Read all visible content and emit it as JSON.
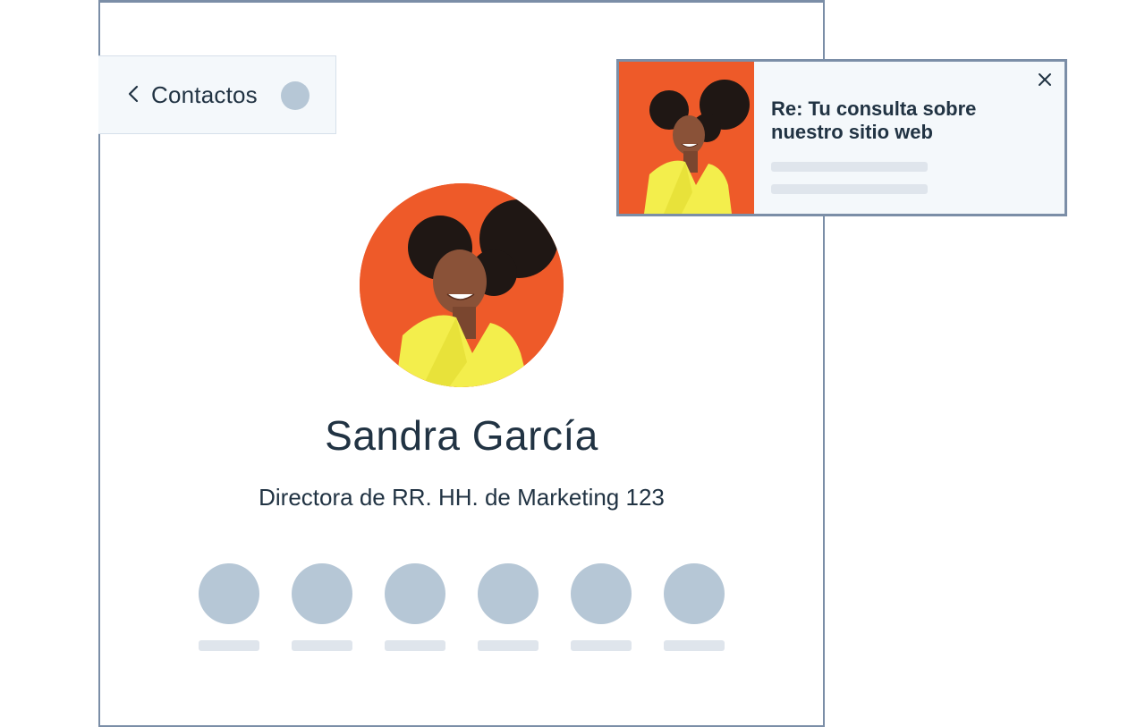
{
  "navigation": {
    "back_label": "Contactos"
  },
  "contact": {
    "name": "Sandra García",
    "title": "Directora de RR. HH. de Marketing 123"
  },
  "actions": [
    {
      "icon": "action-placeholder-icon"
    },
    {
      "icon": "action-placeholder-icon"
    },
    {
      "icon": "action-placeholder-icon"
    },
    {
      "icon": "action-placeholder-icon"
    },
    {
      "icon": "action-placeholder-icon"
    },
    {
      "icon": "action-placeholder-icon"
    }
  ],
  "notification": {
    "subject": "Re: Tu consulta sobre nuestro sitio web"
  },
  "colors": {
    "text": "#213343",
    "border": "#7b8ea7",
    "placeholder_circle": "#b6c7d6",
    "placeholder_bar": "#dfe5ec",
    "panel_bg": "#f4f8fb",
    "photo_bg": "#ee5a29",
    "jacket": "#f3ee4c"
  }
}
